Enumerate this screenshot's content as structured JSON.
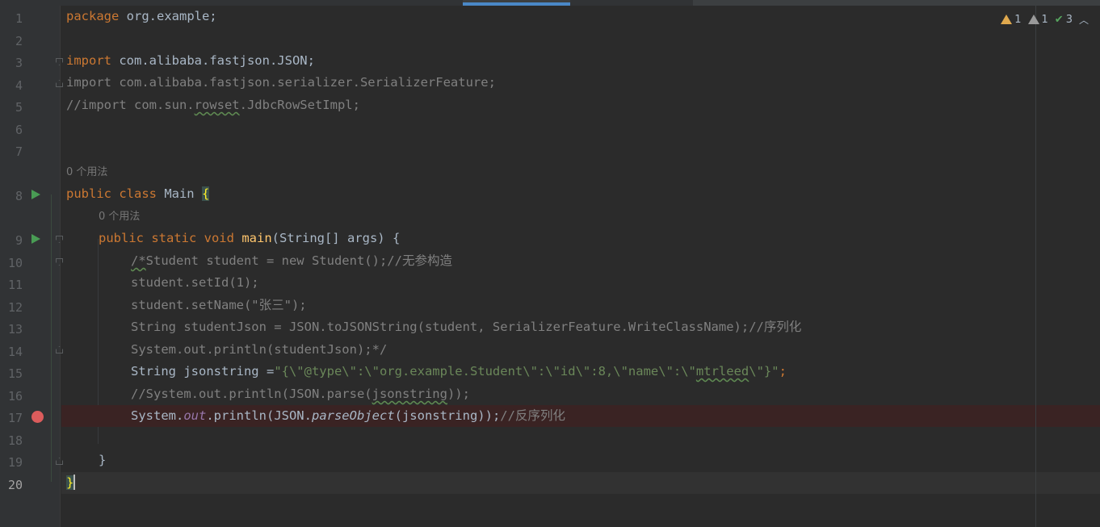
{
  "inspections": {
    "warnings": "1",
    "weak_warnings": "1",
    "typos": "3"
  },
  "usage_hint": "0 个用法",
  "lines": [
    {
      "number": "1"
    },
    {
      "number": "2"
    },
    {
      "number": "3"
    },
    {
      "number": "4"
    },
    {
      "number": "5"
    },
    {
      "number": "6"
    },
    {
      "number": "7"
    },
    {
      "number": "8"
    },
    {
      "number": "9"
    },
    {
      "number": "10"
    },
    {
      "number": "11"
    },
    {
      "number": "12"
    },
    {
      "number": "13"
    },
    {
      "number": "14"
    },
    {
      "number": "15"
    },
    {
      "number": "16"
    },
    {
      "number": "17"
    },
    {
      "number": "18"
    },
    {
      "number": "19"
    },
    {
      "number": "20"
    }
  ],
  "code": {
    "l1": {
      "kw": "package",
      "rest": " org.example;"
    },
    "l3": {
      "kw": "import",
      "rest": " com.alibaba.fastjson.JSON;"
    },
    "l4": {
      "text": "import com.alibaba.fastjson.serializer.SerializerFeature;"
    },
    "l5": {
      "pre": "//import com.sun.",
      "wavy": "rowset",
      "post": ".JdbcRowSetImpl;"
    },
    "l8": {
      "kw": "public class",
      "name": " Main ",
      "brace": "{"
    },
    "l9": {
      "kw": "public static void",
      "fn": "main",
      "rest": "(String[] args) {"
    },
    "l10": {
      "wavy": "/*",
      "rest": "Student student = new Student();//无参构造"
    },
    "l11": {
      "text": "student.setId(1);"
    },
    "l12": {
      "text": "student.setName(\"张三\");"
    },
    "l13": {
      "text": "String studentJson = JSON.toJSONString(student, SerializerFeature.WriteClassName);//序列化"
    },
    "l14": {
      "text": "System.out.println(studentJson);*/"
    },
    "l15": {
      "pre": "String jsonstring =",
      "s1": "\"{\\\"@type\\\":\\\"org.example.Student\\\":\\\"id\\\":8,\\\"name\\\":\\\"",
      "wavy": "mtrleed",
      "s2": "\\\"}\"",
      "end": ";"
    },
    "l16": {
      "pre": "//System.out.println(JSON.parse(",
      "wavy": "jsonstring",
      "post": "));"
    },
    "l17": {
      "a": "System.",
      "out": "out",
      "b": ".println(JSON.",
      "po": "parseObject",
      "c": "(jsonstring));",
      "cm": "//反序列化"
    },
    "l19": {
      "text": "}"
    },
    "l20": {
      "text": "}"
    }
  }
}
